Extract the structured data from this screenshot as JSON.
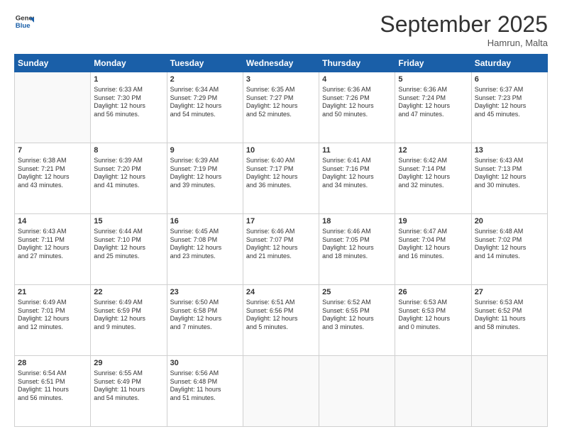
{
  "header": {
    "logo_general": "General",
    "logo_blue": "Blue",
    "month_title": "September 2025",
    "location": "Hamrun, Malta"
  },
  "days_of_week": [
    "Sunday",
    "Monday",
    "Tuesday",
    "Wednesday",
    "Thursday",
    "Friday",
    "Saturday"
  ],
  "weeks": [
    [
      {
        "num": "",
        "info": ""
      },
      {
        "num": "1",
        "info": "Sunrise: 6:33 AM\nSunset: 7:30 PM\nDaylight: 12 hours\nand 56 minutes."
      },
      {
        "num": "2",
        "info": "Sunrise: 6:34 AM\nSunset: 7:29 PM\nDaylight: 12 hours\nand 54 minutes."
      },
      {
        "num": "3",
        "info": "Sunrise: 6:35 AM\nSunset: 7:27 PM\nDaylight: 12 hours\nand 52 minutes."
      },
      {
        "num": "4",
        "info": "Sunrise: 6:36 AM\nSunset: 7:26 PM\nDaylight: 12 hours\nand 50 minutes."
      },
      {
        "num": "5",
        "info": "Sunrise: 6:36 AM\nSunset: 7:24 PM\nDaylight: 12 hours\nand 47 minutes."
      },
      {
        "num": "6",
        "info": "Sunrise: 6:37 AM\nSunset: 7:23 PM\nDaylight: 12 hours\nand 45 minutes."
      }
    ],
    [
      {
        "num": "7",
        "info": "Sunrise: 6:38 AM\nSunset: 7:21 PM\nDaylight: 12 hours\nand 43 minutes."
      },
      {
        "num": "8",
        "info": "Sunrise: 6:39 AM\nSunset: 7:20 PM\nDaylight: 12 hours\nand 41 minutes."
      },
      {
        "num": "9",
        "info": "Sunrise: 6:39 AM\nSunset: 7:19 PM\nDaylight: 12 hours\nand 39 minutes."
      },
      {
        "num": "10",
        "info": "Sunrise: 6:40 AM\nSunset: 7:17 PM\nDaylight: 12 hours\nand 36 minutes."
      },
      {
        "num": "11",
        "info": "Sunrise: 6:41 AM\nSunset: 7:16 PM\nDaylight: 12 hours\nand 34 minutes."
      },
      {
        "num": "12",
        "info": "Sunrise: 6:42 AM\nSunset: 7:14 PM\nDaylight: 12 hours\nand 32 minutes."
      },
      {
        "num": "13",
        "info": "Sunrise: 6:43 AM\nSunset: 7:13 PM\nDaylight: 12 hours\nand 30 minutes."
      }
    ],
    [
      {
        "num": "14",
        "info": "Sunrise: 6:43 AM\nSunset: 7:11 PM\nDaylight: 12 hours\nand 27 minutes."
      },
      {
        "num": "15",
        "info": "Sunrise: 6:44 AM\nSunset: 7:10 PM\nDaylight: 12 hours\nand 25 minutes."
      },
      {
        "num": "16",
        "info": "Sunrise: 6:45 AM\nSunset: 7:08 PM\nDaylight: 12 hours\nand 23 minutes."
      },
      {
        "num": "17",
        "info": "Sunrise: 6:46 AM\nSunset: 7:07 PM\nDaylight: 12 hours\nand 21 minutes."
      },
      {
        "num": "18",
        "info": "Sunrise: 6:46 AM\nSunset: 7:05 PM\nDaylight: 12 hours\nand 18 minutes."
      },
      {
        "num": "19",
        "info": "Sunrise: 6:47 AM\nSunset: 7:04 PM\nDaylight: 12 hours\nand 16 minutes."
      },
      {
        "num": "20",
        "info": "Sunrise: 6:48 AM\nSunset: 7:02 PM\nDaylight: 12 hours\nand 14 minutes."
      }
    ],
    [
      {
        "num": "21",
        "info": "Sunrise: 6:49 AM\nSunset: 7:01 PM\nDaylight: 12 hours\nand 12 minutes."
      },
      {
        "num": "22",
        "info": "Sunrise: 6:49 AM\nSunset: 6:59 PM\nDaylight: 12 hours\nand 9 minutes."
      },
      {
        "num": "23",
        "info": "Sunrise: 6:50 AM\nSunset: 6:58 PM\nDaylight: 12 hours\nand 7 minutes."
      },
      {
        "num": "24",
        "info": "Sunrise: 6:51 AM\nSunset: 6:56 PM\nDaylight: 12 hours\nand 5 minutes."
      },
      {
        "num": "25",
        "info": "Sunrise: 6:52 AM\nSunset: 6:55 PM\nDaylight: 12 hours\nand 3 minutes."
      },
      {
        "num": "26",
        "info": "Sunrise: 6:53 AM\nSunset: 6:53 PM\nDaylight: 12 hours\nand 0 minutes."
      },
      {
        "num": "27",
        "info": "Sunrise: 6:53 AM\nSunset: 6:52 PM\nDaylight: 11 hours\nand 58 minutes."
      }
    ],
    [
      {
        "num": "28",
        "info": "Sunrise: 6:54 AM\nSunset: 6:51 PM\nDaylight: 11 hours\nand 56 minutes."
      },
      {
        "num": "29",
        "info": "Sunrise: 6:55 AM\nSunset: 6:49 PM\nDaylight: 11 hours\nand 54 minutes."
      },
      {
        "num": "30",
        "info": "Sunrise: 6:56 AM\nSunset: 6:48 PM\nDaylight: 11 hours\nand 51 minutes."
      },
      {
        "num": "",
        "info": ""
      },
      {
        "num": "",
        "info": ""
      },
      {
        "num": "",
        "info": ""
      },
      {
        "num": "",
        "info": ""
      }
    ]
  ]
}
